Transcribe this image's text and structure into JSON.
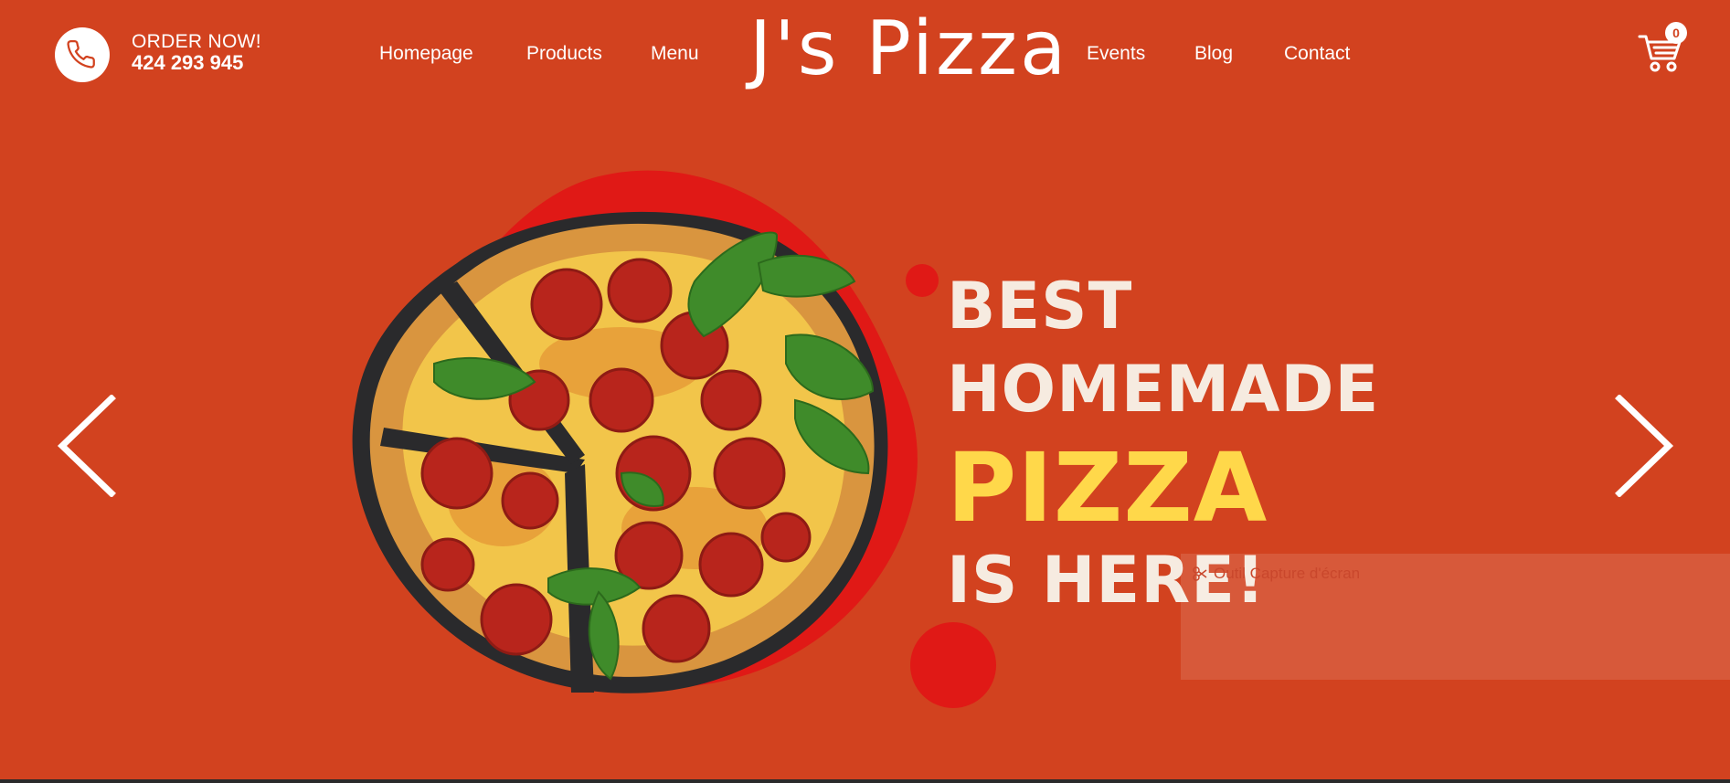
{
  "header": {
    "order_label": "ORDER NOW!",
    "order_number": "424 293 945",
    "brand": "J's Pizza",
    "nav_left": [
      "Homepage",
      "Products",
      "Menu"
    ],
    "nav_right": [
      "Events",
      "Blog",
      "Contact"
    ],
    "cart_count": "0"
  },
  "hero": {
    "line1": "BEST",
    "line2": "HOMEMADE",
    "line3": "PIZZA",
    "line4": "IS HERE!"
  },
  "overlay": {
    "title": "Outil Capture d'écran"
  },
  "colors": {
    "background": "#d2421f",
    "blob": "#e01916",
    "headline_light": "#f6ebe0",
    "headline_accent": "#ffd84a",
    "white": "#ffffff"
  },
  "icons": {
    "phone": "phone-icon",
    "cart": "cart-icon",
    "prev": "chevron-left-icon",
    "next": "chevron-right-icon",
    "snip": "scissors-icon"
  }
}
